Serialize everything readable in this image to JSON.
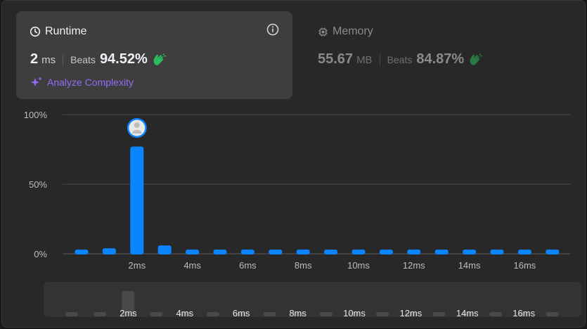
{
  "runtime": {
    "title": "Runtime",
    "value": "2",
    "unit": "ms",
    "beats_label": "Beats",
    "beats_percent": "94.52%",
    "analyze_label": "Analyze Complexity"
  },
  "memory": {
    "title": "Memory",
    "value": "55.67",
    "unit": "MB",
    "beats_label": "Beats",
    "beats_percent": "84.87%"
  },
  "colors": {
    "accent_bar": "#0a84ff",
    "brush_bar": "#4a4a4a",
    "clap_green": "#2cbb5d",
    "analyze_purple": "#8e6cf5"
  },
  "icons": [
    "clock-icon",
    "info-icon",
    "sparkle-icon",
    "chip-icon",
    "clap-icon",
    "avatar"
  ],
  "chart_data": {
    "type": "bar",
    "y_ticks": [
      "100%",
      "50%",
      "0%"
    ],
    "ylim": [
      0,
      100
    ],
    "x_tick_labels": [
      "2ms",
      "4ms",
      "6ms",
      "8ms",
      "10ms",
      "12ms",
      "14ms",
      "16ms"
    ],
    "values": [
      2,
      4,
      77,
      6,
      2,
      2,
      2,
      2,
      2,
      2,
      2,
      2,
      2,
      2,
      2,
      2,
      2,
      2
    ],
    "highlighted_index": 2,
    "grid": true,
    "brush": {
      "x_tick_labels": [
        "2ms",
        "4ms",
        "6ms",
        "8ms",
        "10ms",
        "12ms",
        "14ms",
        "16ms"
      ]
    }
  }
}
